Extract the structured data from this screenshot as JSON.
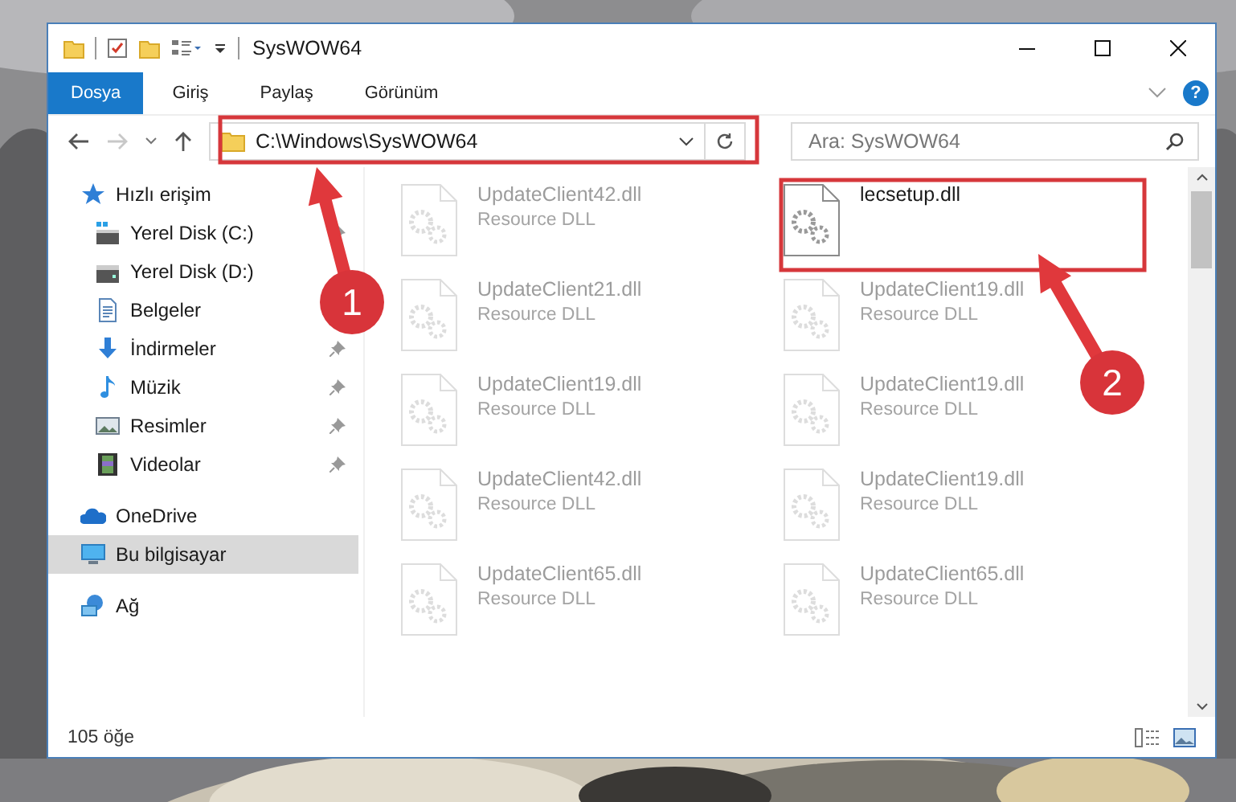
{
  "window": {
    "title": "SysWOW64"
  },
  "ribbon": {
    "tabs": [
      {
        "label": "Dosya",
        "selected": true
      },
      {
        "label": "Giriş",
        "selected": false
      },
      {
        "label": "Paylaş",
        "selected": false
      },
      {
        "label": "Görünüm",
        "selected": false
      }
    ],
    "help": "?"
  },
  "address_bar": {
    "path": "C:\\Windows\\SysWOW64",
    "forward_disabled": true
  },
  "search": {
    "placeholder": "Ara: SysWOW64"
  },
  "sidebar": {
    "items": [
      {
        "label": "Hızlı erişim",
        "pinned": false,
        "selected": false
      },
      {
        "label": "Yerel Disk (C:)",
        "pinned": true,
        "selected": false
      },
      {
        "label": "Yerel Disk (D:)",
        "pinned": false,
        "selected": false
      },
      {
        "label": "Belgeler",
        "pinned": false,
        "selected": false
      },
      {
        "label": "İndirmeler",
        "pinned": true,
        "selected": false
      },
      {
        "label": "Müzik",
        "pinned": true,
        "selected": false
      },
      {
        "label": "Resimler",
        "pinned": true,
        "selected": false
      },
      {
        "label": "Videolar",
        "pinned": true,
        "selected": false
      },
      {
        "label": "OneDrive",
        "pinned": false,
        "selected": false
      },
      {
        "label": "Bu bilgisayar",
        "pinned": false,
        "selected": true
      },
      {
        "label": "Ağ",
        "pinned": false,
        "selected": false
      }
    ]
  },
  "files": [
    {
      "name": "UpdateClient42.dll",
      "type": "Resource DLL",
      "dimmed": true
    },
    {
      "name": "lecsetup.dll",
      "dimmed": false
    },
    {
      "name": "UpdateClient21.dll",
      "type": "Resource DLL",
      "dimmed": true
    },
    {
      "name": "UpdateClient19.dll",
      "type": "Resource DLL",
      "dimmed": true
    },
    {
      "name": "UpdateClient19.dll",
      "type": "Resource DLL",
      "dimmed": true
    },
    {
      "name": "UpdateClient19.dll",
      "type": "Resource DLL",
      "dimmed": true
    },
    {
      "name": "UpdateClient42.dll",
      "type": "Resource DLL",
      "dimmed": true
    },
    {
      "name": "UpdateClient19.dll",
      "type": "Resource DLL",
      "dimmed": true
    },
    {
      "name": "UpdateClient65.dll",
      "type": "Resource DLL",
      "dimmed": true
    },
    {
      "name": "UpdateClient65.dll",
      "type": "Resource DLL",
      "dimmed": true
    }
  ],
  "status_bar": {
    "count": "105 öğe"
  },
  "annotations": [
    {
      "number": "1"
    },
    {
      "number": "2"
    }
  ]
}
